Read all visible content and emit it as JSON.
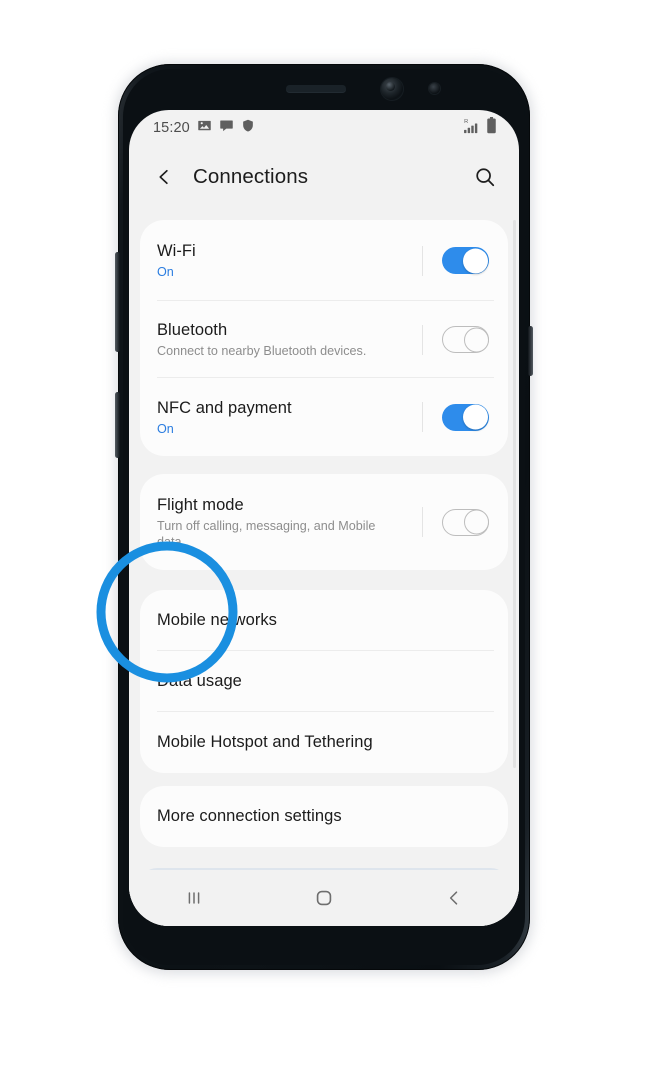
{
  "device": {
    "name": "samsung-galaxy-s8",
    "hardware": {
      "earpiece": "earpiece-speaker",
      "front_camera": "front-camera-icon",
      "proximity_sensor": "proximity-sensor-icon",
      "volume_button": "volume-button",
      "bixby_button": "bixby-button",
      "power_button": "power-button"
    }
  },
  "status_bar": {
    "time": "15:20",
    "left_icons": [
      "image-icon",
      "message-icon",
      "shield-icon"
    ],
    "right_icons": [
      "signal-roaming-icon",
      "battery-icon"
    ],
    "roaming_label": "R"
  },
  "app_bar": {
    "back_icon": "back-chevron-icon",
    "title": "Connections",
    "search_icon": "search-icon"
  },
  "colors": {
    "accent_blue": "#2e8ceb",
    "annotation_blue": "#1a8fe0",
    "screen_bg": "#f2f2f2",
    "card_bg": "#fcfcfc",
    "title_text": "#1b1b1b",
    "sub_text": "#8d8d8d",
    "on_text": "#2b7de0",
    "partial_card": "#dee5ed"
  },
  "cards": [
    {
      "id": "card-toggles",
      "rows": [
        {
          "name": "wifi",
          "title": "Wi-Fi",
          "subtitle": "On",
          "subtitle_state": "on",
          "toggle": "on"
        },
        {
          "name": "bluetooth",
          "title": "Bluetooth",
          "subtitle": "Connect to nearby Bluetooth devices.",
          "subtitle_state": "normal",
          "toggle": "off"
        },
        {
          "name": "nfc-and-payment",
          "title": "NFC and payment",
          "subtitle": "On",
          "subtitle_state": "on",
          "toggle": "on"
        }
      ]
    },
    {
      "id": "card-flight-mode",
      "rows": [
        {
          "name": "flight-mode",
          "title": "Flight mode",
          "subtitle": "Turn off calling, messaging, and Mobile data.",
          "subtitle_state": "normal",
          "toggle": "off"
        }
      ]
    },
    {
      "id": "card-mobile",
      "rows": [
        {
          "name": "mobile-networks",
          "title": "Mobile networks",
          "toggle": "none"
        },
        {
          "name": "data-usage",
          "title": "Data usage",
          "toggle": "none"
        },
        {
          "name": "mobile-hotspot-and-tethering",
          "title": "Mobile Hotspot and Tethering",
          "toggle": "none"
        }
      ]
    },
    {
      "id": "card-more",
      "rows": [
        {
          "name": "more-connection-settings",
          "title": "More connection settings",
          "toggle": "none"
        }
      ]
    }
  ],
  "nav_bar": {
    "recents_icon": "recents-icon",
    "home_icon": "home-icon",
    "back_icon": "back-icon"
  },
  "annotation": {
    "shape": "circle",
    "target": "Mobile networks",
    "color": "#1a8fe0"
  }
}
